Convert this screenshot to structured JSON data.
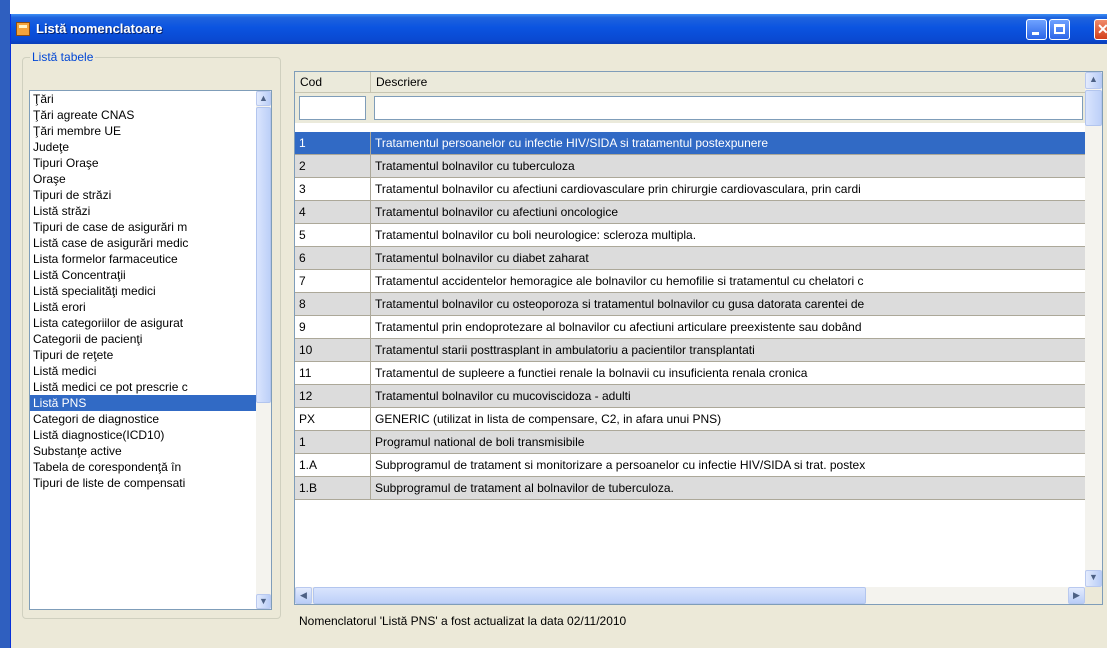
{
  "window": {
    "title": "Listă nomenclatoare"
  },
  "sidebar": {
    "legend": "Listă tabele",
    "items": [
      "Ţări",
      "Ţări agreate CNAS",
      "Ţări membre UE",
      "Judeţe",
      "Tipuri Oraşe",
      "Oraşe",
      "Tipuri de străzi",
      "Listă străzi",
      "Tipuri de case de asigurări m",
      "Listă case de asigurări medic",
      "Lista formelor farmaceutice",
      "Listă Concentraţii",
      "Listă specialităţi medici",
      "Listă erori",
      "Lista categoriilor de asigurat",
      "Categorii de pacienţi",
      "Tipuri de reţete",
      "Listă medici",
      "Listă medici ce pot prescrie c",
      "Listă PNS",
      "Categori de diagnostice",
      "Listă diagnostice(ICD10)",
      "Substanţe active",
      "Tabela de corespondenţă în",
      "Tipuri de liste de compensati"
    ],
    "selected_index": 19
  },
  "grid": {
    "columns": [
      "Cod",
      "Descriere"
    ],
    "selected_index": 0,
    "rows": [
      {
        "cod": "1",
        "descriere": "Tratamentul persoanelor cu infectie HIV/SIDA si tratamentul postexpunere"
      },
      {
        "cod": "2",
        "descriere": "Tratamentul bolnavilor cu tuberculoza"
      },
      {
        "cod": "3",
        "descriere": "Tratamentul bolnavilor cu afectiuni cardiovasculare prin chirurgie cardiovasculara, prin cardi"
      },
      {
        "cod": "4",
        "descriere": "Tratamentul bolnavilor cu afectiuni oncologice"
      },
      {
        "cod": "5",
        "descriere": "Tratamentul bolnavilor cu boli neurologice: scleroza multipla."
      },
      {
        "cod": "6",
        "descriere": "Tratamentul bolnavilor cu diabet zaharat"
      },
      {
        "cod": "7",
        "descriere": "Tratamentul accidentelor hemoragice ale bolnavilor cu hemofilie si tratamentul cu chelatori c"
      },
      {
        "cod": "8",
        "descriere": "Tratamentul bolnavilor cu osteoporoza si tratamentul bolnavilor cu gusa datorata carentei de"
      },
      {
        "cod": "9",
        "descriere": "Tratamentul prin endoprotezare al bolnavilor cu afectiuni articulare preexistente sau dobând"
      },
      {
        "cod": "10",
        "descriere": "Tratamentul starii posttrasplant in ambulatoriu a pacientilor transplantati"
      },
      {
        "cod": "11",
        "descriere": "Tratamentul de supleere a functiei renale la bolnavii cu insuficienta renala cronica"
      },
      {
        "cod": "12",
        "descriere": "Tratamentul bolnavilor cu mucoviscidoza - adulti"
      },
      {
        "cod": "PX",
        "descriere": "GENERIC (utilizat in lista de compensare, C2, in afara unui PNS)"
      },
      {
        "cod": "1",
        "descriere": "Programul national de boli transmisibile"
      },
      {
        "cod": "1.A",
        "descriere": "Subprogramul de tratament si monitorizare a persoanelor cu infectie HIV/SIDA si trat. postex"
      },
      {
        "cod": "1.B",
        "descriere": "Subprogramul de tratament al bolnavilor de tuberculoza."
      }
    ]
  },
  "status": {
    "text": "Nomenclatorul 'Listă PNS' a fost actualizat la data 02/11/2010"
  },
  "icons": {
    "app": "app-icon",
    "minimize": "minimize-icon",
    "maximize": "maximize-icon",
    "close": "close-icon",
    "scroll_up": "arrow-up-icon",
    "scroll_down": "arrow-down-icon",
    "scroll_left": "arrow-left-icon",
    "scroll_right": "arrow-right-icon"
  },
  "colors": {
    "titlebar": "#0a49d2",
    "selection": "#316ac5",
    "alt_row": "#dcdcdc",
    "legend_text": "#0046d5"
  }
}
